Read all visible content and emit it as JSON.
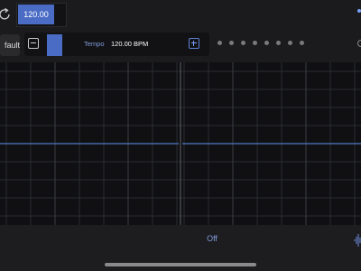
{
  "colors": {
    "accent": "#4b6cc5",
    "accent_text": "#7f9ad9",
    "background": "#1b1b1d",
    "grid_background": "#101012",
    "grid_line": "#2a2d31",
    "trace": "#4f78c8"
  },
  "header": {
    "refresh_icon": "refresh-icon",
    "value": "120.00"
  },
  "preset": {
    "label": "fault"
  },
  "tempo": {
    "label": "Tempo",
    "value": "120.00 BPM",
    "decrement_icon": "minus-icon",
    "increment_icon": "plus-icon"
  },
  "pagination": {
    "count": 8
  },
  "bottom": {
    "status": "Off",
    "wave_icon": "waveform-icon"
  }
}
